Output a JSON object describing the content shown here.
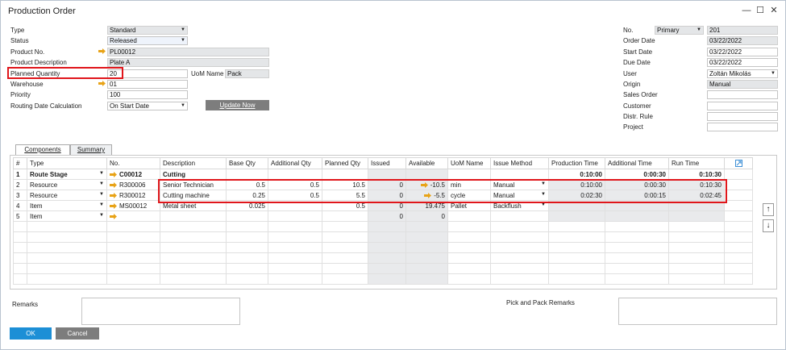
{
  "window": {
    "title": "Production Order"
  },
  "header_left": {
    "type_label": "Type",
    "type_value": "Standard",
    "status_label": "Status",
    "status_value": "Released",
    "product_no_label": "Product No.",
    "product_no_value": "PL00012",
    "product_desc_label": "Product Description",
    "product_desc_value": "Plate A",
    "planned_qty_label": "Planned Quantity",
    "planned_qty_value": "20",
    "uom_name_label": "UoM Name",
    "uom_name_value": "Pack",
    "warehouse_label": "Warehouse",
    "warehouse_value": "01",
    "priority_label": "Priority",
    "priority_value": "100",
    "routing_label": "Routing Date Calculation",
    "routing_value": "On Start Date",
    "update_now_label": "Update Now"
  },
  "header_right": {
    "no_label": "No.",
    "series_value": "Primary",
    "no_value": "201",
    "order_date_label": "Order Date",
    "order_date_value": "03/22/2022",
    "start_date_label": "Start Date",
    "start_date_value": "03/22/2022",
    "due_date_label": "Due Date",
    "due_date_value": "03/22/2022",
    "user_label": "User",
    "user_value": "Zoltán Mikolás",
    "origin_label": "Origin",
    "origin_value": "Manual",
    "sales_order_label": "Sales Order",
    "customer_label": "Customer",
    "distr_rule_label": "Distr. Rule",
    "project_label": "Project"
  },
  "tabs": [
    {
      "label": "Components"
    },
    {
      "label": "Summary"
    }
  ],
  "grid": {
    "columns": [
      "#",
      "Type",
      "No.",
      "Description",
      "Base Qty",
      "Additional Qty",
      "Planned Qty",
      "Issued",
      "Available",
      "UoM Name",
      "Issue Method",
      "Production Time",
      "Additional Time",
      "Run Time"
    ],
    "rows": [
      {
        "num": "1",
        "type": "Route Stage",
        "no": "C00012",
        "desc": "Cutting",
        "base": "",
        "addl": "",
        "planned": "",
        "issued": "",
        "avail": "",
        "uom": "",
        "method": "",
        "prod_time": "0:10:00",
        "addl_time": "0:00:30",
        "run_time": "0:10:30"
      },
      {
        "num": "2",
        "type": "Resource",
        "no": "R300006",
        "desc": "Senior Technician",
        "base": "0.5",
        "addl": "0.5",
        "planned": "10.5",
        "issued": "0",
        "avail": "-10.5",
        "uom": "min",
        "method": "Manual",
        "prod_time": "0:10:00",
        "addl_time": "0:00:30",
        "run_time": "0:10:30"
      },
      {
        "num": "3",
        "type": "Resource",
        "no": "R300012",
        "desc": "Cutting machine",
        "base": "0.25",
        "addl": "0.5",
        "planned": "5.5",
        "issued": "0",
        "avail": "-5.5",
        "uom": "cycle",
        "method": "Manual",
        "prod_time": "0:02:30",
        "addl_time": "0:00:15",
        "run_time": "0:02:45"
      },
      {
        "num": "4",
        "type": "Item",
        "no": "MS00012",
        "desc": "Metal sheet",
        "base": "0.025",
        "addl": "",
        "planned": "0.5",
        "issued": "0",
        "avail": "19.475",
        "uom": "Pallet",
        "method": "Backflush",
        "prod_time": "",
        "addl_time": "",
        "run_time": ""
      },
      {
        "num": "5",
        "type": "Item",
        "no": "",
        "desc": "",
        "base": "",
        "addl": "",
        "planned": "",
        "issued": "0",
        "avail": "0",
        "uom": "",
        "method": "",
        "prod_time": "",
        "addl_time": "",
        "run_time": ""
      }
    ]
  },
  "footer": {
    "remarks_label": "Remarks",
    "pick_pack_label": "Pick and Pack Remarks",
    "ok_label": "OK",
    "cancel_label": "Cancel"
  },
  "colors": {
    "highlight": "#e0161b",
    "ok_button": "#1c8fd6",
    "cancel_button": "#7d7d7d",
    "arrow": "#e8a317"
  }
}
